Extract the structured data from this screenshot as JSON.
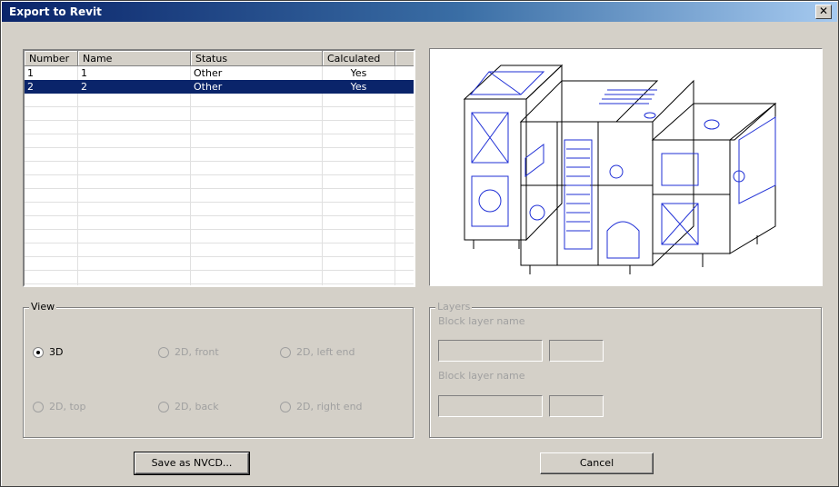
{
  "window": {
    "title": "Export to Revit",
    "close_glyph": "✕"
  },
  "table": {
    "columns": [
      "Number",
      "Name",
      "Status",
      "Calculated"
    ],
    "rows": [
      {
        "number": "1",
        "name": "1",
        "status": "Other",
        "calculated": "Yes",
        "selected": false
      },
      {
        "number": "2",
        "name": "2",
        "status": "Other",
        "calculated": "Yes",
        "selected": true
      }
    ]
  },
  "preview": {
    "icon": "air-handling-unit-drawing"
  },
  "view": {
    "label": "View",
    "options": [
      {
        "label": "3D",
        "checked": true,
        "enabled": true
      },
      {
        "label": "2D, front",
        "checked": false,
        "enabled": false
      },
      {
        "label": "2D, left end",
        "checked": false,
        "enabled": false
      },
      {
        "label": "2D, top",
        "checked": false,
        "enabled": false
      },
      {
        "label": "2D, back",
        "checked": false,
        "enabled": false
      },
      {
        "label": "2D, right end",
        "checked": false,
        "enabled": false
      }
    ]
  },
  "layers": {
    "label": "Layers",
    "block1_label": "Block layer name",
    "block2_label": "Block layer name"
  },
  "buttons": {
    "save": "Save as NVCD...",
    "cancel": "Cancel"
  },
  "colors": {
    "selection": "#0a246a",
    "titlebar_start": "#0a246a",
    "drawing_blue": "#1f2fd6"
  }
}
